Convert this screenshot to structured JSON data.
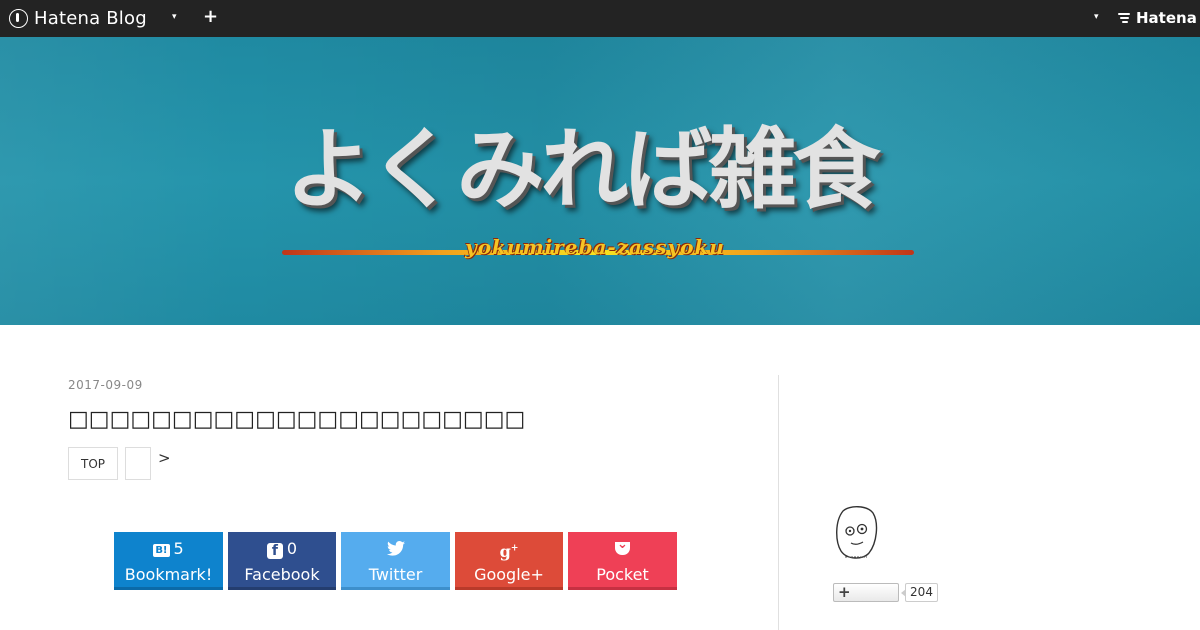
{
  "topbar": {
    "brand_label": "Hatena Blog",
    "add_label": "+",
    "menu_caret": "▾",
    "account_caret": "▾",
    "hatena_label": "Hatena"
  },
  "banner": {
    "title": "よくみれば雑食",
    "subtitle": "yokumireba-zassyoku"
  },
  "post": {
    "date": "2017-09-09",
    "title": "□□□□□□□□□□□□□□□□□□□□□□",
    "breadcrumb_top": "TOP",
    "breadcrumb_sep": ">"
  },
  "share": {
    "bookmark": {
      "count": "5",
      "label": "Bookmark!",
      "color": "#0e83cd"
    },
    "facebook": {
      "count": "0",
      "label": "Facebook",
      "color": "#2f4f8f"
    },
    "twitter": {
      "label": "Twitter",
      "color": "#55acee"
    },
    "googleplus": {
      "label": "Google+",
      "color": "#dd4b39"
    },
    "pocket": {
      "label": "Pocket",
      "color": "#ef4056"
    }
  },
  "sidebar": {
    "follow_label": "+",
    "follow_count": "204"
  },
  "colors": {
    "topbar": "#232323",
    "banner": "#1f8aa2"
  }
}
